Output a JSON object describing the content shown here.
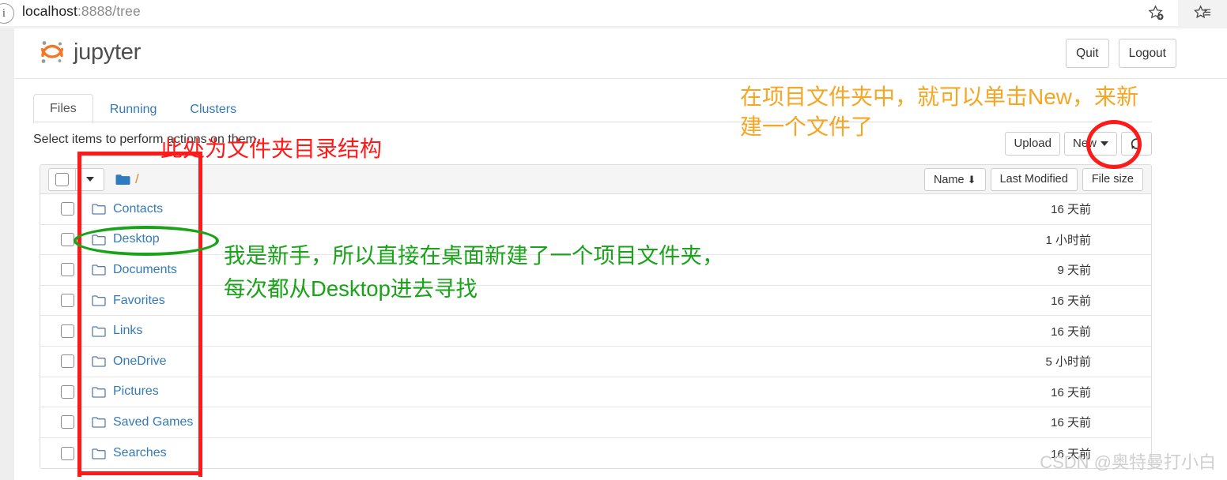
{
  "browser": {
    "info_icon": "info-icon",
    "url_host": "localhost",
    "url_path": ":8888/tree",
    "bookmark_add_icon": "star-plus-icon",
    "favorites_icon": "star-list-icon"
  },
  "header": {
    "logo_text": "jupyter",
    "logo_icon": "jupyter-logo-icon",
    "quit_label": "Quit",
    "logout_label": "Logout"
  },
  "tabs": [
    {
      "label": "Files",
      "active": true
    },
    {
      "label": "Running",
      "active": false
    },
    {
      "label": "Clusters",
      "active": false
    }
  ],
  "toolbar": {
    "select_note": "Select items to perform actions on them.",
    "upload_label": "Upload",
    "new_label": "New",
    "new_caret_icon": "chevron-down-icon",
    "refresh_icon": "refresh-icon"
  },
  "list_header": {
    "select_all_checkbox": "select-all-checkbox",
    "select_menu_caret": "chevron-down-icon",
    "folder_icon": "folder-icon",
    "breadcrumb_root": "/",
    "sort_name": "Name",
    "sort_name_arrow": "↓",
    "sort_last_modified": "Last Modified",
    "sort_file_size": "File size"
  },
  "files": [
    {
      "name": "Contacts",
      "modified": "16 天前"
    },
    {
      "name": "Desktop",
      "modified": "1 小时前"
    },
    {
      "name": "Documents",
      "modified": "9 天前"
    },
    {
      "name": "Favorites",
      "modified": "16 天前"
    },
    {
      "name": "Links",
      "modified": "16 天前"
    },
    {
      "name": "OneDrive",
      "modified": "5 小时前"
    },
    {
      "name": "Pictures",
      "modified": "16 天前"
    },
    {
      "name": "Saved Games",
      "modified": "16 天前"
    },
    {
      "name": "Searches",
      "modified": "16 天前"
    }
  ],
  "annotations": {
    "orange_text": "在项目文件夹中，就可以单击New，来新\n建一个文件了",
    "red_text": "此处为文件夹目录结构",
    "green_text": "我是新手，所以直接在桌面新建了一个项目文件夹，\n每次都从Desktop进去寻找",
    "colors": {
      "orange": "#f5a623",
      "red": "#ff1a1a",
      "green": "#19a319"
    }
  },
  "watermark": "CSDN @奥特曼打小白"
}
